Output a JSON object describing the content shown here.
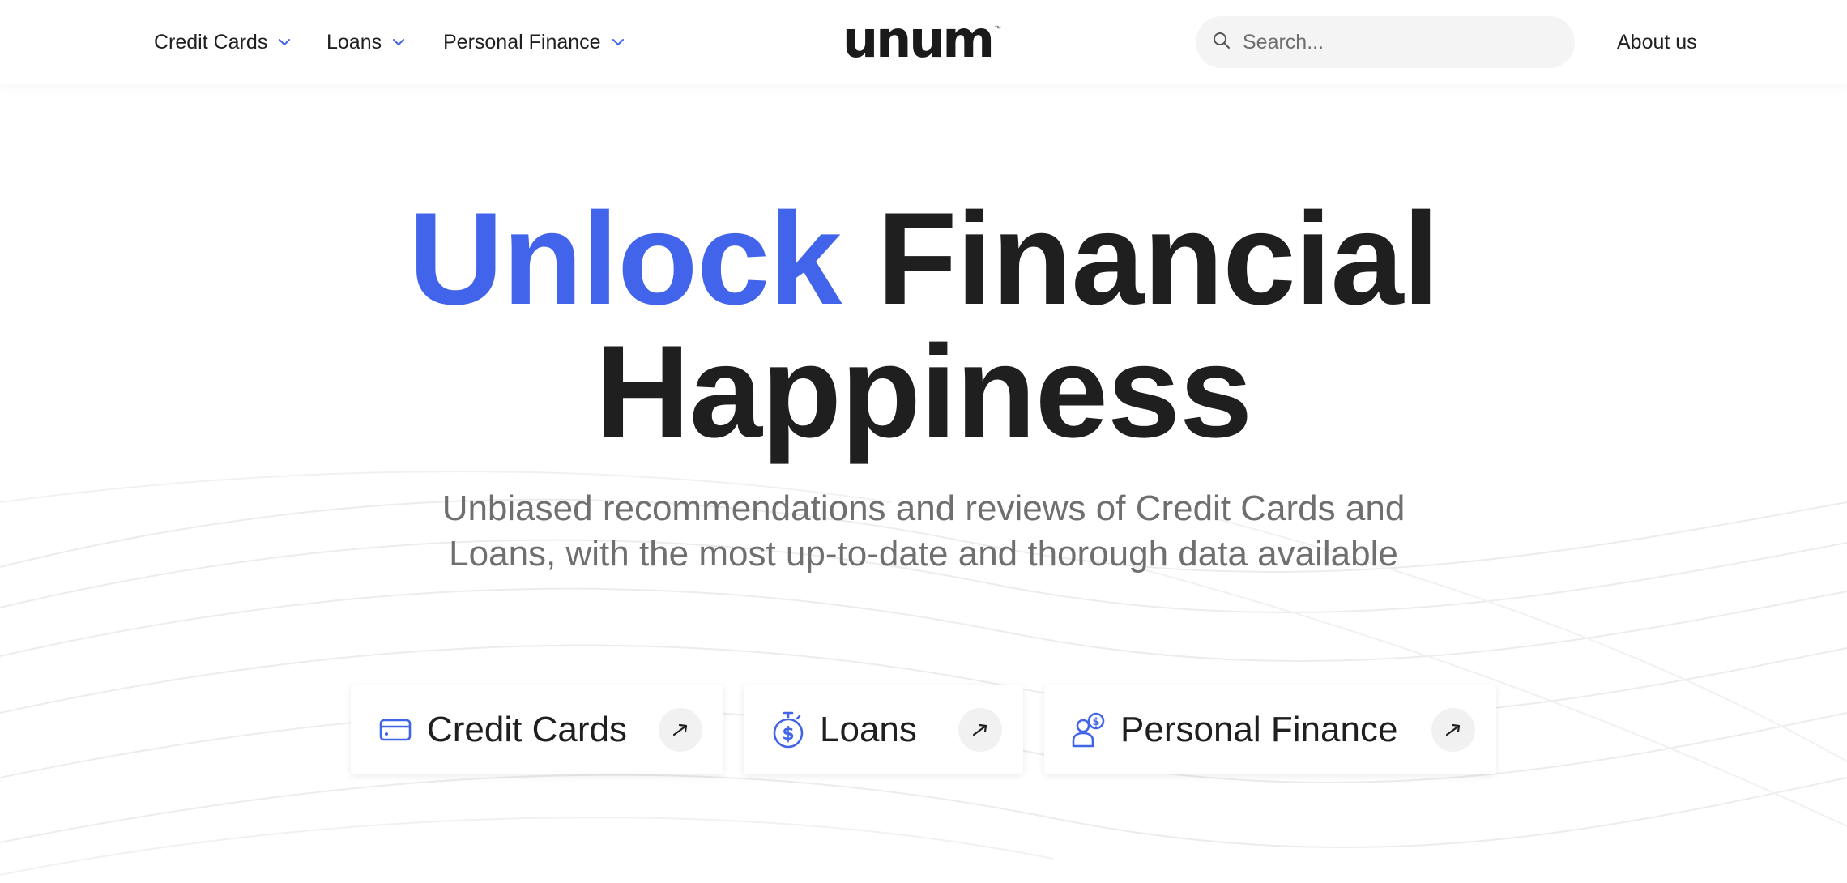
{
  "brand": {
    "logo_text": "unum",
    "trademark": "™"
  },
  "nav": {
    "items": [
      {
        "label": "Credit Cards"
      },
      {
        "label": "Loans"
      },
      {
        "label": "Personal Finance"
      }
    ],
    "about_label": "About us"
  },
  "search": {
    "placeholder": "Search..."
  },
  "hero": {
    "title_accent": "Unlock",
    "title_rest": "Financial",
    "title_line2": "Happiness",
    "subtitle": "Unbiased recommendations and reviews of Credit Cards and Loans, with the most up-to-date and thorough data available"
  },
  "cards": [
    {
      "label": "Credit Cards",
      "icon": "credit-card-icon"
    },
    {
      "label": "Loans",
      "icon": "stopwatch-dollar-icon"
    },
    {
      "label": "Personal Finance",
      "icon": "person-dollar-icon"
    }
  ],
  "colors": {
    "accent": "#4264ea",
    "text": "#1f1f1f",
    "muted": "#6f6f6f",
    "search_bg": "#f4f4f4"
  }
}
